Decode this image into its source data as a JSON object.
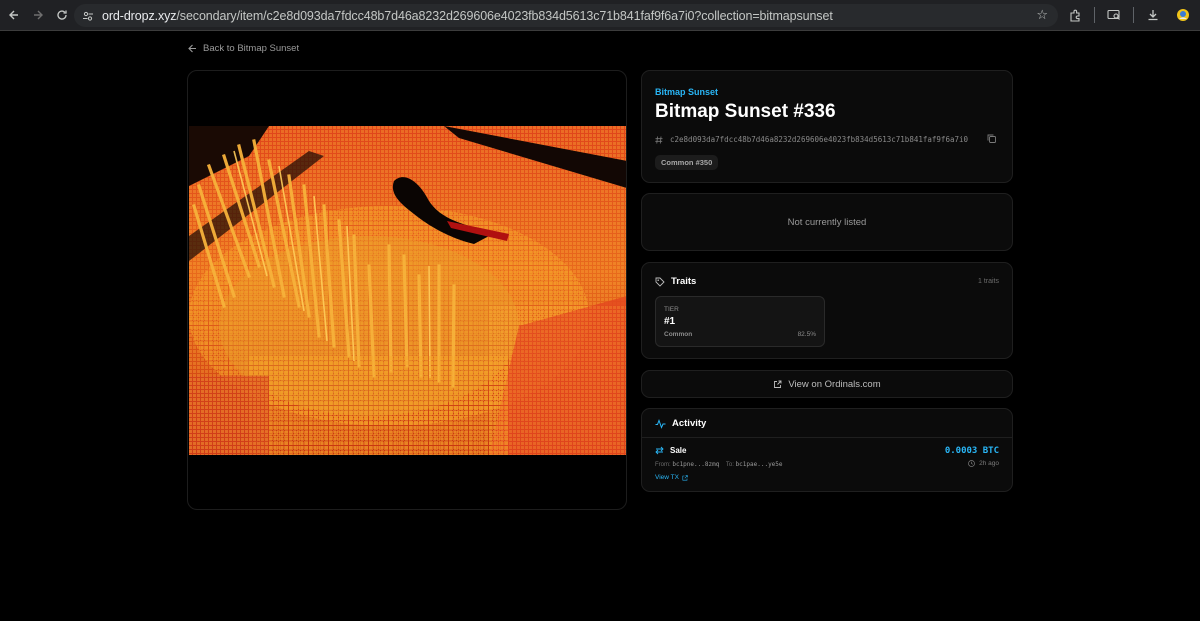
{
  "browser": {
    "url_host": "ord-dropz.xyz",
    "url_path": "/secondary/item/c2e8d093da7fdcc48b7d46a8232d269606e4023fb834d5613c71b841faf9f6a7i0?collection=bitmapsunset",
    "icons": [
      "back-icon",
      "forward-icon",
      "reload-icon",
      "site-info-icon",
      "star-icon",
      "extensions-icon",
      "tab-search-icon",
      "download-icon",
      "profile-icon",
      "menu-icon"
    ]
  },
  "page": {
    "back_label": "Back to Bitmap Sunset",
    "collection": "Bitmap Sunset",
    "title": "Bitmap Sunset #336",
    "inscription_id": "c2e8d093da7fdcc48b7d46a8232d269606e4023fb834d5613c71b841faf9f6a7i0",
    "badge": "Common #350",
    "listing_status": "Not currently listed",
    "traits": {
      "heading": "Traits",
      "count_label": "1 traits",
      "items": [
        {
          "type": "TIER",
          "value": "#1",
          "rarity": "Common",
          "percent": "82.5%"
        }
      ]
    },
    "view_link": "View on Ordinals.com",
    "activity": {
      "heading": "Activity",
      "events": [
        {
          "type": "Sale",
          "price": "0.0003 BTC",
          "from_label": "From:",
          "from_addr": "bc1pne...8zmq",
          "to_label": "To:",
          "to_addr": "bc1pae...ye5e",
          "time": "2h ago",
          "tx_label": "View TX"
        }
      ]
    }
  },
  "colors": {
    "accent": "#29b6f6",
    "background": "#000000",
    "card": "#0b0b0b"
  }
}
